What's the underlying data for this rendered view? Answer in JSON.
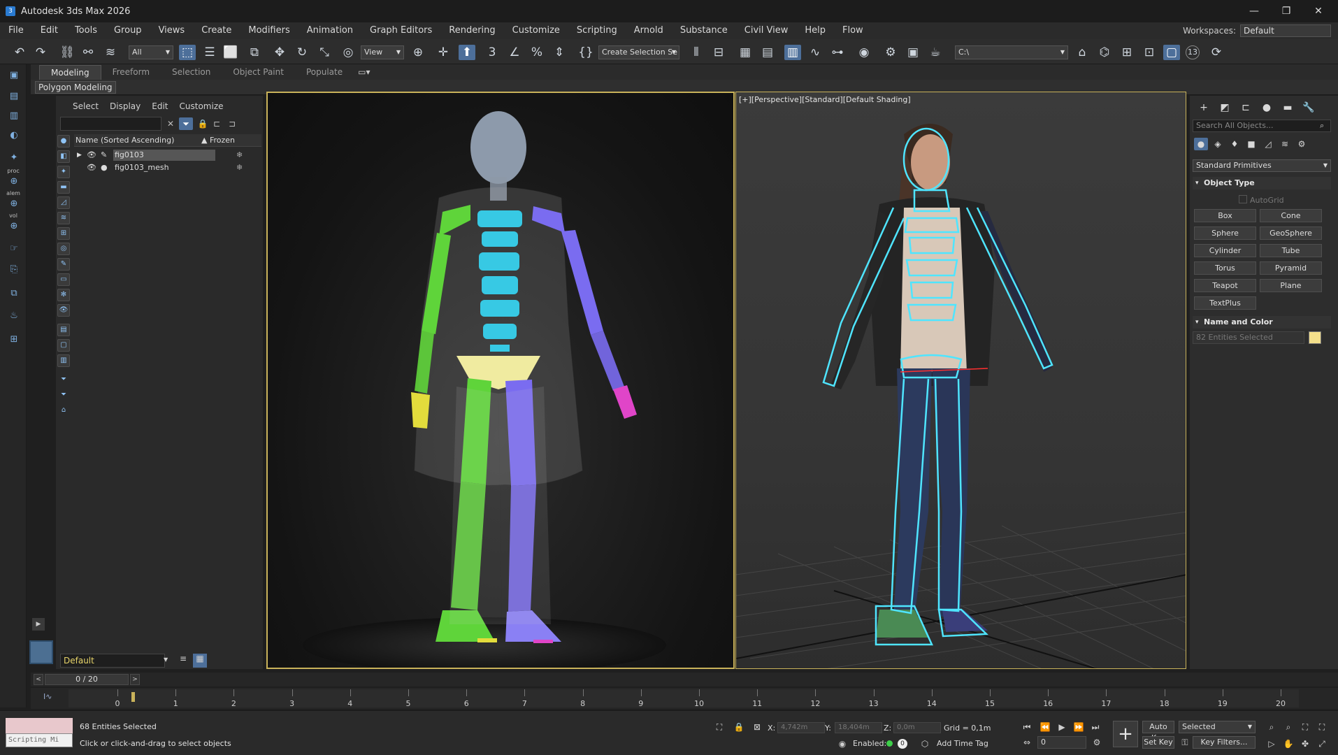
{
  "window": {
    "title": "Autodesk 3ds Max 2026",
    "app_icon": "3"
  },
  "menu": [
    "File",
    "Edit",
    "Tools",
    "Group",
    "Views",
    "Create",
    "Modifiers",
    "Animation",
    "Graph Editors",
    "Rendering",
    "Customize",
    "Scripting",
    "Arnold",
    "Substance",
    "Civil View",
    "Help",
    "Flow"
  ],
  "workspaces": {
    "label": "Workspaces:",
    "value": "Default"
  },
  "toolbar": {
    "filter_value": "All",
    "ref_coord_value": "View",
    "named_selection": "Create Selection Se",
    "path_value": "C:\\",
    "badge": "13"
  },
  "ribbon": {
    "tabs": [
      "Modeling",
      "Freeform",
      "Selection",
      "Object Paint",
      "Populate"
    ],
    "active_tab": "Modeling",
    "panel_label": "Polygon Modeling"
  },
  "left_strip": {
    "labels": [
      "proc",
      "alem",
      "vol"
    ]
  },
  "scene_explorer": {
    "menu": [
      "Select",
      "Display",
      "Edit",
      "Customize"
    ],
    "column_name": "Name (Sorted Ascending)",
    "column_frozen": "▲ Frozen",
    "rows": [
      {
        "name": "fig0103",
        "selected": true
      },
      {
        "name": "fig0103_mesh",
        "selected": false
      }
    ],
    "layer": "Default"
  },
  "viewport": {
    "right_label": "[+][Perspective][Standard][Default Shading]"
  },
  "command_panel": {
    "search_placeholder": "Search All Objects...",
    "primitives_dropdown": "Standard Primitives",
    "object_type_header": "Object Type",
    "autogrid": "AutoGrid",
    "buttons": [
      "Box",
      "Cone",
      "Sphere",
      "GeoSphere",
      "Cylinder",
      "Tube",
      "Torus",
      "Pyramid",
      "Teapot",
      "Plane",
      "TextPlus"
    ],
    "name_color_header": "Name and Color",
    "name_field": "82 Entities Selected",
    "swatch_color": "#f4e08b"
  },
  "timeline": {
    "frame_counter": "0 / 20",
    "ticks": [
      "0",
      "1",
      "2",
      "3",
      "4",
      "5",
      "6",
      "7",
      "8",
      "9",
      "10",
      "11",
      "12",
      "13",
      "14",
      "15",
      "16",
      "17",
      "18",
      "19",
      "20"
    ]
  },
  "status": {
    "mini_listener": "Scripting Mi",
    "selection_count": "68 Entities Selected",
    "prompt": "Click or click-and-drag to select objects",
    "x_label": "X:",
    "x_value": "4,742m",
    "y_label": "Y:",
    "y_value": "18,404m",
    "z_label": "Z:",
    "z_value": "0,0m",
    "grid": "Grid = 0,1m",
    "enabled_label": "Enabled:",
    "enabled_value": "0",
    "add_time_tag": "Add Time Tag",
    "auto_key": "Auto Key",
    "set_key": "Set Key",
    "selected_dropdown": "Selected",
    "key_filters": "Key Filters...",
    "current_frame": "0"
  }
}
